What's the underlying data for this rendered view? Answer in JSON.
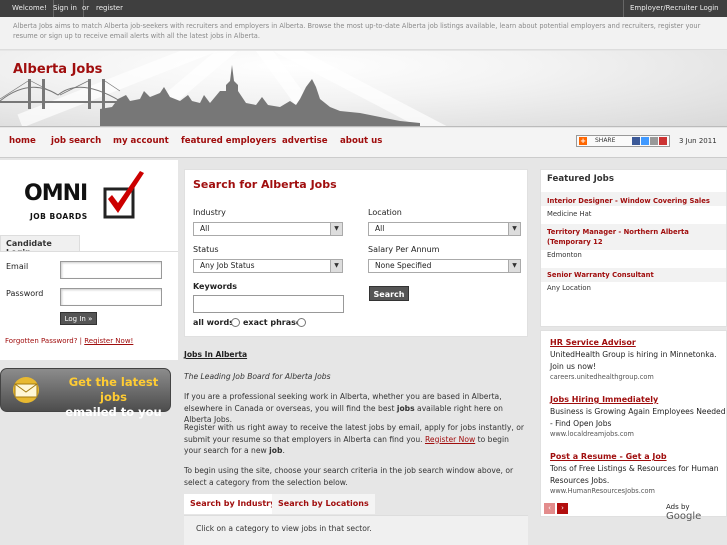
{
  "topbar": {
    "welcome": "Welcome!",
    "sign_in": "Sign in",
    "or": "or",
    "register": "register",
    "employer_login": "Employer/Recruiter Login"
  },
  "intro_text": "Alberta Jobs aims to match Alberta job-seekers with recruiters and employers in Alberta. Browse the most up-to-date Alberta job listings available, learn about potential employers and recruiters, register your resume or sign up to receive email alerts with all the latest jobs in Alberta.",
  "banner": {
    "title": "Alberta Jobs"
  },
  "nav": [
    "home",
    "job search",
    "my account",
    "featured employers",
    "advertise",
    "about us"
  ],
  "share_label": "SHARE",
  "date": "3 Jun 2011",
  "logo": {
    "word": "OMNI",
    "sub": "JOB BOARDS"
  },
  "candidate_login": {
    "title": "Candidate Login",
    "email_label": "Email",
    "password_label": "Password",
    "login_button": "Log In »",
    "forgot": "Forgotten Password?",
    "divider": "|",
    "register": "Register Now!"
  },
  "email_banner": {
    "line1": "Get the latest jobs",
    "line2": "emailed to you"
  },
  "search": {
    "title": "Search for Alberta Jobs",
    "industry_label": "Industry",
    "industry_value": "All",
    "location_label": "Location",
    "location_value": "All",
    "status_label": "Status",
    "status_value": "Any Job Status",
    "salary_label": "Salary Per Annum",
    "salary_value": "None Specified",
    "keywords_label": "Keywords",
    "all_words": "all words",
    "exact_phrase": "exact phrase",
    "button": "Search"
  },
  "content": {
    "heading": "Jobs In Alberta",
    "tagline": "The Leading Job Board for Alberta Jobs",
    "p1_a": "If you are a professional seeking work in Alberta, whether you are based in Alberta, elsewhere in Canada or overseas, you will find the best ",
    "p1_bold": "jobs",
    "p1_b": " available right here on Alberta Jobs.",
    "p2_a": "Register with us right away to receive the latest jobs by email, apply for jobs instantly, or submit your resume so that employers in Alberta can find you. ",
    "p2_link": "Register Now",
    "p2_b": " to begin your search for a new ",
    "p2_bold": "job",
    "p2_c": ".",
    "p3": "To begin using the site, choose your search criteria in the job search window above, or select a category from the selection below."
  },
  "tabs": [
    "Search by Industry",
    "Search by Locations"
  ],
  "tab_panel_text": "Click on a category to view jobs in that sector.",
  "featured": {
    "title": "Featured Jobs",
    "jobs": [
      {
        "title": "Interior Designer - Window Covering Sales",
        "location": "Medicine Hat"
      },
      {
        "title": "Territory Manager - Northern Alberta (Temporary 12",
        "location": "Edmonton"
      },
      {
        "title": "Senior Warranty Consultant",
        "location": "Any Location"
      }
    ]
  },
  "ads": {
    "items": [
      {
        "title": "HR Service Advisor",
        "body": "UnitedHealth Group is hiring in Minnetonka. Join us now!",
        "url": "careers.unitedhealthgroup.com"
      },
      {
        "title": "Jobs Hiring Immediately",
        "body": "Business is Growing Again Employees Needed - Find Open Jobs",
        "url": "www.localdreamjobs.com"
      },
      {
        "title": "Post a Resume - Get a Job",
        "body": "Tons of Free Listings & Resources for Human Resources Jobs.",
        "url": "www.HumanResourcesJobs.com"
      }
    ],
    "ads_by": "Ads by",
    "google": "Google",
    "prev": "‹",
    "next": "›"
  },
  "colors": {
    "brand": "#a00e0e",
    "topbar": "#3f3f3f"
  }
}
